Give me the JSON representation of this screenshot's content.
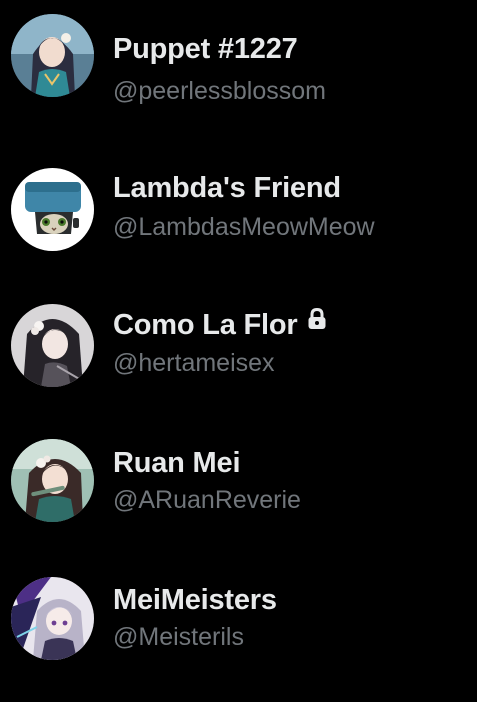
{
  "accounts": [
    {
      "display_name": "Puppet #1227",
      "handle": "@peerlessblossom",
      "protected": false,
      "avatar_icon": "anime-girl-teal-avatar"
    },
    {
      "display_name": "Lambda's Friend",
      "handle": "@LambdasMeowMeow",
      "protected": false,
      "avatar_icon": "cat-box-avatar"
    },
    {
      "display_name": "Como La Flor",
      "handle": "@hertameisex",
      "protected": true,
      "avatar_icon": "anime-girl-dark-hair-avatar"
    },
    {
      "display_name": "Ruan Mei",
      "handle": "@ARuanReverie",
      "protected": false,
      "avatar_icon": "anime-girl-flute-avatar"
    },
    {
      "display_name": "MeiMeisters",
      "handle": "@Meisterils",
      "protected": false,
      "avatar_icon": "anime-girl-purple-avatar"
    }
  ],
  "colors": {
    "background": "#000000",
    "name_text": "#e7e9ea",
    "handle_text": "#71767b"
  }
}
